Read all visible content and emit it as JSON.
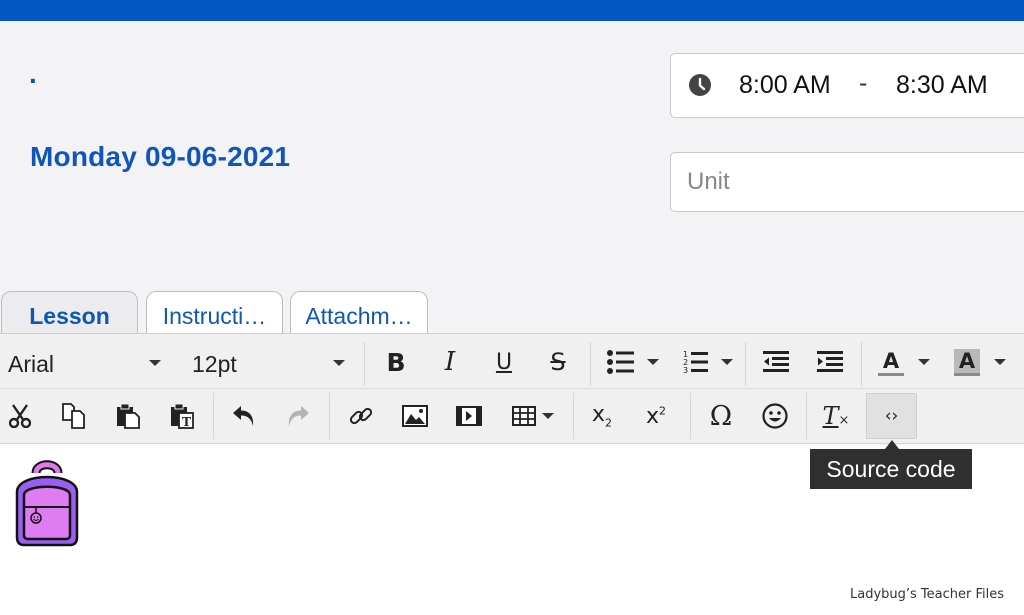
{
  "header": {
    "title_dot": ".",
    "date_title": "Monday 09-06-2021",
    "time": {
      "start": "8:00 AM",
      "separator": "-",
      "end": "8:30 AM",
      "icon": "clock-icon"
    },
    "unit": {
      "value": "",
      "placeholder": "Unit"
    }
  },
  "tabs": [
    {
      "label": "Lesson",
      "active": true
    },
    {
      "label": "Instructi…",
      "active": false
    },
    {
      "label": "Attachm…",
      "active": false
    }
  ],
  "toolbar": {
    "font_family": "Arial",
    "font_size": "12pt",
    "row1_icons": [
      "bold-icon",
      "italic-icon",
      "underline-icon",
      "strikethrough-icon",
      "bullet-list-icon",
      "numbered-list-icon",
      "outdent-icon",
      "indent-icon",
      "text-color-icon",
      "background-color-icon"
    ],
    "row2_icons": [
      "cut-icon",
      "copy-icon",
      "paste-icon",
      "paste-as-text-icon",
      "undo-icon",
      "redo-icon",
      "link-icon",
      "image-icon",
      "media-icon",
      "table-icon",
      "subscript-icon",
      "superscript-icon",
      "special-character-icon",
      "emoticons-icon",
      "clear-formatting-icon",
      "source-code-icon"
    ],
    "text_color": "#8a8a8a",
    "background_color": "#b9b9b9"
  },
  "tooltip": {
    "text": "Source code"
  },
  "editor": {
    "image": "backpack-icon"
  },
  "watermark": "Ladybug’s Teacher Files",
  "colors": {
    "brand": "#0257c0",
    "title": "#0f56b8"
  }
}
